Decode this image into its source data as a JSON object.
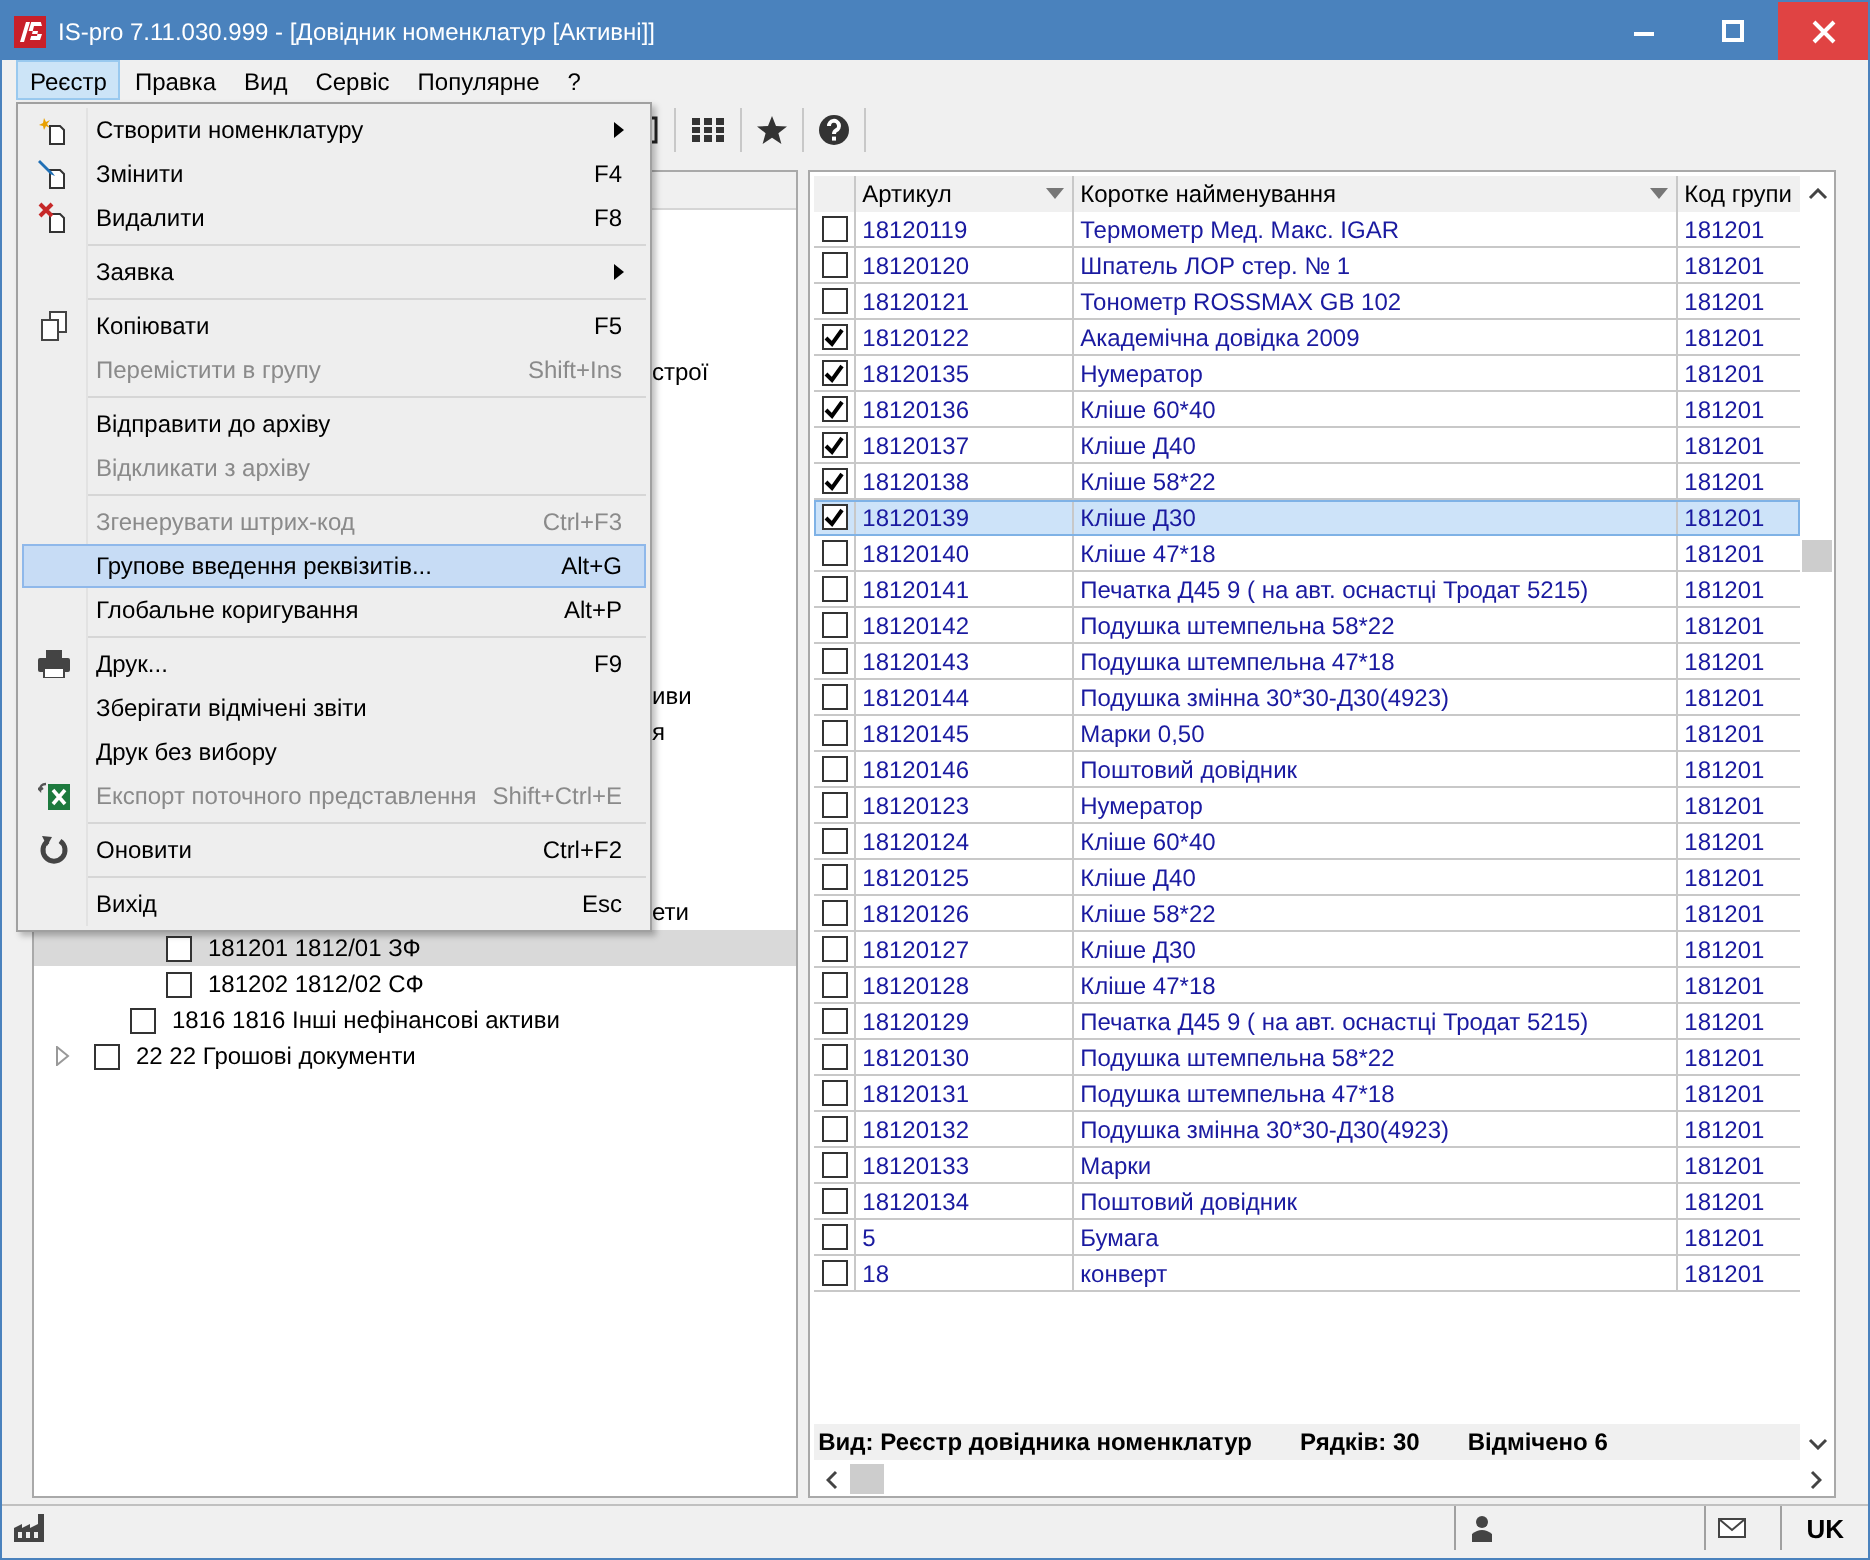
{
  "window": {
    "title": "IS-pro 7.11.030.999 - [Довідник номенклатур [Активні]]"
  },
  "menubar": [
    {
      "label": "Реєстр",
      "selected": true
    },
    {
      "label": "Правка",
      "selected": false
    },
    {
      "label": "Вид",
      "selected": false
    },
    {
      "label": "Сервіс",
      "selected": false
    },
    {
      "label": "Популярне",
      "selected": false
    },
    {
      "label": "?",
      "selected": false
    }
  ],
  "menu": {
    "items": [
      {
        "kind": "item",
        "label": "Створити номенклатуру",
        "submenu": true,
        "disabled": false,
        "selected": false
      },
      {
        "kind": "item",
        "label": "Змінити",
        "shortcut": "F4",
        "disabled": false,
        "selected": false
      },
      {
        "kind": "item",
        "label": "Видалити",
        "shortcut": "F8",
        "disabled": false,
        "selected": false
      },
      {
        "kind": "separator"
      },
      {
        "kind": "item",
        "label": "Заявка",
        "submenu": true,
        "disabled": false,
        "selected": false
      },
      {
        "kind": "separator"
      },
      {
        "kind": "item",
        "label": "Копіювати",
        "shortcut": "F5",
        "disabled": false,
        "selected": false
      },
      {
        "kind": "item",
        "label": "Перемістити в групу",
        "shortcut": "Shift+Ins",
        "disabled": true,
        "selected": false
      },
      {
        "kind": "separator"
      },
      {
        "kind": "item",
        "label": "Відправити до архіву",
        "disabled": false,
        "selected": false
      },
      {
        "kind": "item",
        "label": "Відкликати з архіву",
        "disabled": true,
        "selected": false
      },
      {
        "kind": "separator"
      },
      {
        "kind": "item",
        "label": "Згенерувати штрих-код",
        "shortcut": "Ctrl+F3",
        "disabled": true,
        "selected": false
      },
      {
        "kind": "item",
        "label": "Групове введення реквізитів...",
        "shortcut": "Alt+G",
        "disabled": false,
        "selected": true
      },
      {
        "kind": "item",
        "label": "Глобальне коригування",
        "shortcut": "Alt+P",
        "disabled": false,
        "selected": false
      },
      {
        "kind": "separator"
      },
      {
        "kind": "item",
        "label": "Друк...",
        "shortcut": "F9",
        "disabled": false,
        "selected": false
      },
      {
        "kind": "item",
        "label": "Зберігати відмічені звіти",
        "disabled": false,
        "selected": false
      },
      {
        "kind": "item",
        "label": "Друк без вибору",
        "disabled": false,
        "selected": false
      },
      {
        "kind": "item",
        "label": "Експорт поточного представлення",
        "shortcut": "Shift+Ctrl+E",
        "disabled": true,
        "selected": false
      },
      {
        "kind": "separator"
      },
      {
        "kind": "item",
        "label": "Оновити",
        "shortcut": "Ctrl+F2",
        "disabled": false,
        "selected": false
      },
      {
        "kind": "separator"
      },
      {
        "kind": "item",
        "label": "Вихід",
        "shortcut": "Esc",
        "disabled": false,
        "selected": false
      }
    ]
  },
  "tree": {
    "items": [
      {
        "kind": "fragment",
        "text": "строї",
        "selected": false
      },
      {
        "kind": "fragment",
        "text": "иви",
        "selected": false
      },
      {
        "kind": "fragment",
        "text": "я",
        "selected": false
      },
      {
        "kind": "fragment",
        "text": "ети",
        "selected": false,
        "children": [
          {
            "kind": "node",
            "text": "181201 1812/01 ЗФ",
            "checked": false,
            "selected": true
          },
          {
            "kind": "node",
            "text": "181202 1812/02 СФ",
            "checked": false,
            "selected": false
          }
        ]
      },
      {
        "kind": "node",
        "text": "1816 1816 Інші нефінансові активи",
        "checked": false,
        "selected": false
      },
      {
        "kind": "node",
        "text": "22 22 Грошові документи",
        "checked": false,
        "selected": false,
        "expandable": true
      }
    ]
  },
  "table": {
    "columns": [
      {
        "label": "Артикул",
        "filter": true
      },
      {
        "label": "Коротке найменування",
        "filter": true
      },
      {
        "label": "Код групи",
        "filter": false
      }
    ],
    "rows": [
      {
        "checked": false,
        "selected": false,
        "cells": [
          "18120119",
          "Термометр Мед. Макс. IGAR",
          "181201"
        ]
      },
      {
        "checked": false,
        "selected": false,
        "cells": [
          "18120120",
          "Шпатель ЛОР стер. № 1",
          "181201"
        ]
      },
      {
        "checked": false,
        "selected": false,
        "cells": [
          "18120121",
          "Тонометр ROSSMAX GB 102",
          "181201"
        ]
      },
      {
        "checked": true,
        "selected": false,
        "cells": [
          "18120122",
          "Академічна довідка 2009",
          "181201"
        ]
      },
      {
        "checked": true,
        "selected": false,
        "cells": [
          "18120135",
          "Нумератор",
          "181201"
        ]
      },
      {
        "checked": true,
        "selected": false,
        "cells": [
          "18120136",
          "Кліше 60*40",
          "181201"
        ]
      },
      {
        "checked": true,
        "selected": false,
        "cells": [
          "18120137",
          "Кліше Д40",
          "181201"
        ]
      },
      {
        "checked": true,
        "selected": false,
        "cells": [
          "18120138",
          "Кліше 58*22",
          "181201"
        ]
      },
      {
        "checked": true,
        "selected": true,
        "cells": [
          "18120139",
          "Кліше Д30",
          "181201"
        ]
      },
      {
        "checked": false,
        "selected": false,
        "cells": [
          "18120140",
          "Кліше 47*18",
          "181201"
        ]
      },
      {
        "checked": false,
        "selected": false,
        "cells": [
          "18120141",
          "Печатка Д45 9 ( на авт. оснастці Тродат 5215)",
          "181201"
        ]
      },
      {
        "checked": false,
        "selected": false,
        "cells": [
          "18120142",
          "Подушка штемпельна 58*22",
          "181201"
        ]
      },
      {
        "checked": false,
        "selected": false,
        "cells": [
          "18120143",
          "Подушка штемпельна 47*18",
          "181201"
        ]
      },
      {
        "checked": false,
        "selected": false,
        "cells": [
          "18120144",
          "Подушка змінна 30*30-Д30(4923)",
          "181201"
        ]
      },
      {
        "checked": false,
        "selected": false,
        "cells": [
          "18120145",
          "Марки 0,50",
          "181201"
        ]
      },
      {
        "checked": false,
        "selected": false,
        "cells": [
          "18120146",
          "Поштовий довідник",
          "181201"
        ]
      },
      {
        "checked": false,
        "selected": false,
        "cells": [
          "18120123",
          "Нумератор",
          "181201"
        ]
      },
      {
        "checked": false,
        "selected": false,
        "cells": [
          "18120124",
          "Кліше 60*40",
          "181201"
        ]
      },
      {
        "checked": false,
        "selected": false,
        "cells": [
          "18120125",
          "Кліше Д40",
          "181201"
        ]
      },
      {
        "checked": false,
        "selected": false,
        "cells": [
          "18120126",
          "Кліше 58*22",
          "181201"
        ]
      },
      {
        "checked": false,
        "selected": false,
        "cells": [
          "18120127",
          "Кліше Д30",
          "181201"
        ]
      },
      {
        "checked": false,
        "selected": false,
        "cells": [
          "18120128",
          "Кліше 47*18",
          "181201"
        ]
      },
      {
        "checked": false,
        "selected": false,
        "cells": [
          "18120129",
          "Печатка Д45 9 ( на авт. оснастці Тродат 5215)",
          "181201"
        ]
      },
      {
        "checked": false,
        "selected": false,
        "cells": [
          "18120130",
          "Подушка штемпельна 58*22",
          "181201"
        ]
      },
      {
        "checked": false,
        "selected": false,
        "cells": [
          "18120131",
          "Подушка штемпельна 47*18",
          "181201"
        ]
      },
      {
        "checked": false,
        "selected": false,
        "cells": [
          "18120132",
          "Подушка змінна 30*30-Д30(4923)",
          "181201"
        ]
      },
      {
        "checked": false,
        "selected": false,
        "cells": [
          "18120133",
          "Марки",
          "181201"
        ]
      },
      {
        "checked": false,
        "selected": false,
        "cells": [
          "18120134",
          "Поштовий довідник",
          "181201"
        ]
      },
      {
        "checked": false,
        "selected": false,
        "cells": [
          "5",
          "Бумага",
          "181201"
        ]
      },
      {
        "checked": false,
        "selected": false,
        "cells": [
          "18",
          "конверт",
          "181201"
        ]
      }
    ]
  },
  "footer": {
    "view": "Вид: Реєстр довідника номенклатур",
    "rows": "Рядків: 30",
    "marked": "Відмічено 6"
  },
  "status_bar": {
    "language": "UK"
  }
}
